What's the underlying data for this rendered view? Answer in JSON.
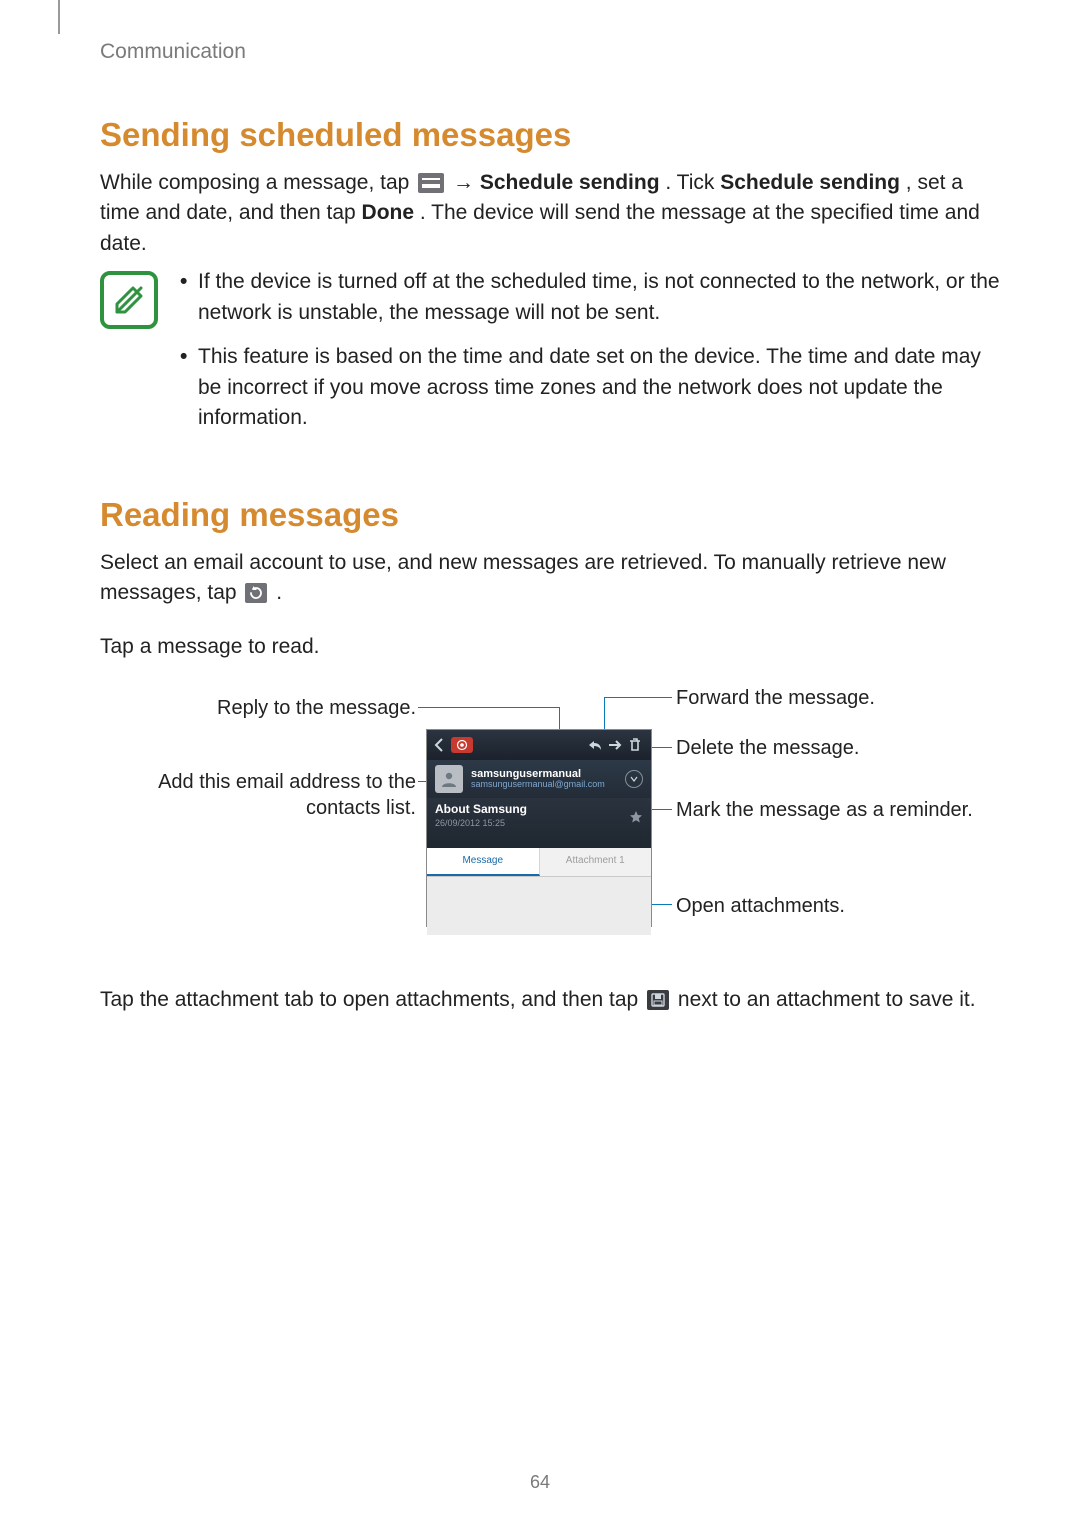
{
  "breadcrumb": "Communication",
  "page_number": "64",
  "section1": {
    "title": "Sending scheduled messages",
    "para_parts": {
      "p1a": "While composing a message, tap ",
      "p1b": " → ",
      "p1c": "Schedule sending",
      "p1d": ". Tick ",
      "p1e": "Schedule sending",
      "p1f": ", set a time and date, and then tap ",
      "p1g": "Done",
      "p1h": ". The device will send the message at the specified time and date."
    },
    "notes": [
      "If the device is turned off at the scheduled time, is not connected to the network, or the network is unstable, the message will not be sent.",
      "This feature is based on the time and date set on the device. The time and date may be incorrect if you move across time zones and the network does not update the information."
    ]
  },
  "section2": {
    "title": "Reading messages",
    "para1_parts": {
      "a": "Select an email account to use, and new messages are retrieved. To manually retrieve new messages, tap ",
      "b": "."
    },
    "para2": "Tap a message to read.",
    "para3_parts": {
      "a": "Tap the attachment tab to open attachments, and then tap ",
      "b": " next to an attachment to save it."
    }
  },
  "callouts": {
    "left1": "Reply to the message.",
    "left2a": "Add this email address to the",
    "left2b": "contacts list.",
    "right1": "Forward the message.",
    "right2": "Delete the message.",
    "right3": "Mark the message as a reminder.",
    "right4": "Open attachments."
  },
  "phone": {
    "sender_name": "samsungusermanual",
    "sender_email": "samsungusermanual@gmail.com",
    "subject": "About Samsung",
    "subject_date": "26/09/2012  15:25",
    "tab_message": "Message",
    "tab_attachment": "Attachment 1"
  }
}
